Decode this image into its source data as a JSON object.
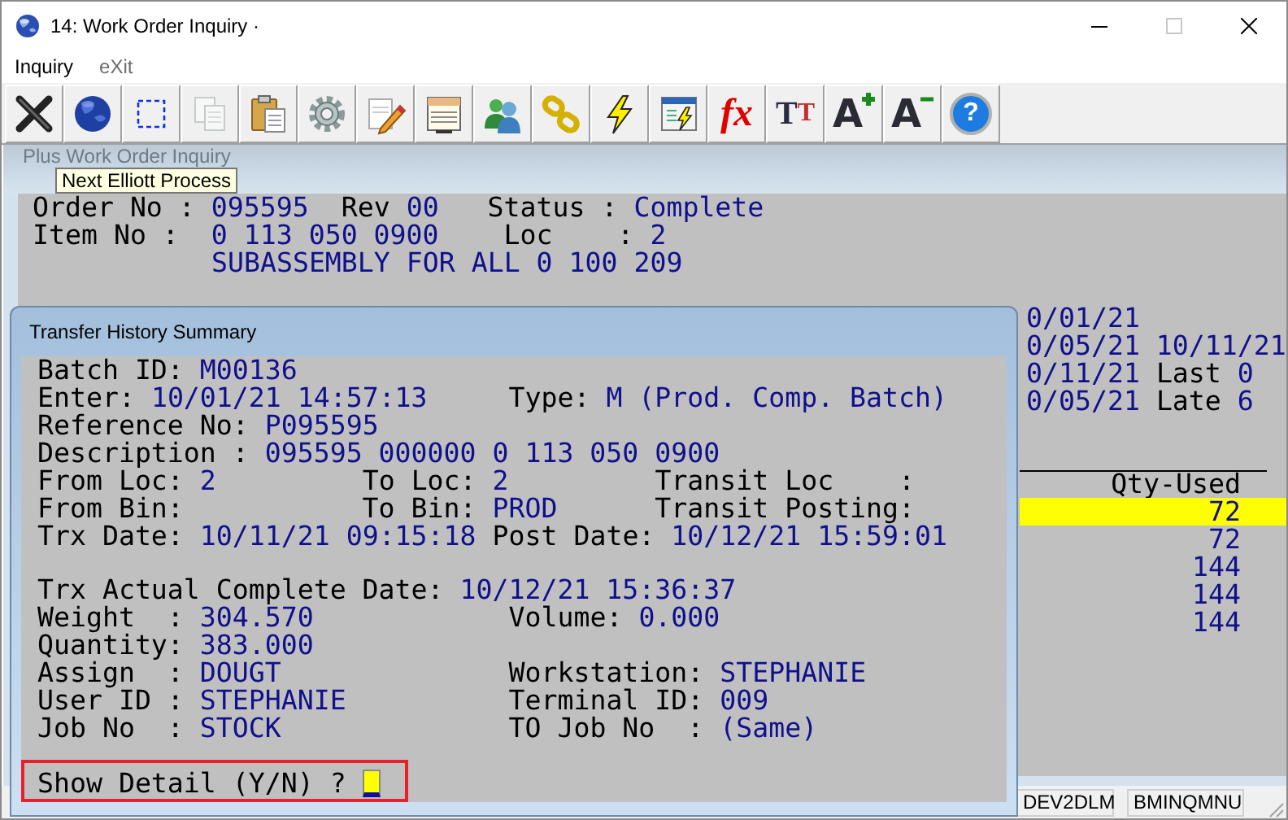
{
  "window": {
    "title": "14: Work Order Inquiry ·"
  },
  "menu": [
    {
      "label": "Inquiry",
      "disabled": false
    },
    {
      "label": "eXit",
      "disabled": true
    }
  ],
  "toolbar": [
    {
      "kind": "close",
      "disabled": false
    },
    {
      "kind": "globe",
      "disabled": false
    },
    {
      "kind": "select",
      "disabled": false
    },
    {
      "kind": "copy",
      "disabled": true
    },
    {
      "kind": "paste",
      "disabled": false
    },
    {
      "kind": "gear",
      "disabled": false
    },
    {
      "kind": "edit",
      "disabled": false
    },
    {
      "kind": "notes",
      "disabled": false
    },
    {
      "kind": "users",
      "disabled": false
    },
    {
      "kind": "chain",
      "disabled": false
    },
    {
      "kind": "lightning",
      "disabled": false
    },
    {
      "kind": "window_lightning",
      "disabled": false
    },
    {
      "kind": "fx",
      "glyph": "fx",
      "disabled": false
    },
    {
      "kind": "text_size",
      "glyph": "TT",
      "disabled": false
    },
    {
      "kind": "font_larger",
      "glyph": "A",
      "disabled": false
    },
    {
      "kind": "font_smaller",
      "glyph": "A",
      "disabled": false
    },
    {
      "kind": "help",
      "glyph": "?",
      "disabled": false
    }
  ],
  "tooltip": "Next Elliott Process",
  "inquiry_window": {
    "title": "Plus Work Order Inquiry",
    "header_lines": [
      [
        {
          "text": "Order No : ",
          "kind": "label"
        },
        {
          "text": "095595",
          "kind": "value"
        },
        {
          "text": "  Rev ",
          "kind": "label"
        },
        {
          "text": "00",
          "kind": "value"
        },
        {
          "text": "   Status : ",
          "kind": "label"
        },
        {
          "text": "Complete",
          "kind": "value"
        }
      ],
      [
        {
          "text": "Item No :  ",
          "kind": "label"
        },
        {
          "text": "0 113 050 0900",
          "kind": "value"
        },
        {
          "text": "    Loc    : ",
          "kind": "label"
        },
        {
          "text": "2",
          "kind": "value"
        }
      ],
      [
        {
          "text": "SUBASSEMBLY FOR ALL 0 100 209",
          "kind": "value"
        }
      ]
    ],
    "schedule_lines": [
      [
        {
          "text": "0/01/21",
          "kind": "value"
        }
      ],
      [
        {
          "text": "0/05/21 10/11/21",
          "kind": "value"
        }
      ],
      [
        {
          "text": "0/11/21",
          "kind": "value"
        },
        {
          "text": " Last ",
          "kind": "label"
        },
        {
          "text": "0",
          "kind": "value"
        }
      ],
      [
        {
          "text": "0/05/21",
          "kind": "value"
        },
        {
          "text": " Late ",
          "kind": "label"
        },
        {
          "text": "6",
          "kind": "value"
        }
      ]
    ],
    "material_table": {
      "columns": [
        "Qty-Used"
      ],
      "rows": [
        {
          "qty_used": "72",
          "selected": true
        },
        {
          "qty_used": "72",
          "selected": false
        },
        {
          "qty_used": "144",
          "selected": false
        },
        {
          "qty_used": "144",
          "selected": false
        },
        {
          "qty_used": "144",
          "selected": false
        }
      ]
    }
  },
  "dialog": {
    "title": "Transfer History Summary",
    "sections": [
      [
        [
          {
            "text": "Batch ID: ",
            "kind": "label"
          },
          {
            "text": "M00136",
            "kind": "value"
          }
        ],
        [
          {
            "text": "Enter: ",
            "kind": "label"
          },
          {
            "text": "10/01/21 14:57:13",
            "kind": "value"
          },
          {
            "text": "     Type: ",
            "kind": "label"
          },
          {
            "text": "M (Prod. Comp. Batch)",
            "kind": "value"
          }
        ],
        [
          {
            "text": "Reference No: ",
            "kind": "label"
          },
          {
            "text": "P095595",
            "kind": "value"
          }
        ],
        [
          {
            "text": "Description : ",
            "kind": "label"
          },
          {
            "text": "095595 000000 0 113 050 0900",
            "kind": "value"
          }
        ],
        [
          {
            "text": "From Loc: ",
            "kind": "label"
          },
          {
            "text": "2",
            "kind": "value"
          },
          {
            "text": "         To Loc: ",
            "kind": "label"
          },
          {
            "text": "2",
            "kind": "value"
          },
          {
            "text": "         Transit Loc    :",
            "kind": "label"
          }
        ],
        [
          {
            "text": "From Bin:           To Bin: ",
            "kind": "label"
          },
          {
            "text": "PROD",
            "kind": "value"
          },
          {
            "text": "      Transit Posting:",
            "kind": "label"
          }
        ],
        [
          {
            "text": "Trx Date: ",
            "kind": "label"
          },
          {
            "text": "10/11/21 09:15:18",
            "kind": "value"
          },
          {
            "text": " Post Date: ",
            "kind": "label"
          },
          {
            "text": "10/12/21 15:59:01",
            "kind": "value"
          }
        ]
      ],
      [
        [
          {
            "text": "Trx Actual Complete Date: ",
            "kind": "label"
          },
          {
            "text": "10/12/21 15:36:37",
            "kind": "value"
          }
        ],
        [
          {
            "text": "Weight  : ",
            "kind": "label"
          },
          {
            "text": "304.570",
            "kind": "value"
          },
          {
            "text": "            Volume: ",
            "kind": "label"
          },
          {
            "text": "0.000",
            "kind": "value"
          }
        ],
        [
          {
            "text": "Quantity: ",
            "kind": "label"
          },
          {
            "text": "383.000",
            "kind": "value"
          }
        ],
        [
          {
            "text": "Assign  : ",
            "kind": "label"
          },
          {
            "text": "DOUGT",
            "kind": "value"
          },
          {
            "text": "              Workstation: ",
            "kind": "label"
          },
          {
            "text": "STEPHANIE",
            "kind": "value"
          }
        ],
        [
          {
            "text": "User ID : ",
            "kind": "label"
          },
          {
            "text": "STEPHANIE",
            "kind": "value"
          },
          {
            "text": "          Terminal ID: ",
            "kind": "label"
          },
          {
            "text": "009",
            "kind": "value"
          }
        ],
        [
          {
            "text": "Job No  : ",
            "kind": "label"
          },
          {
            "text": "STOCK",
            "kind": "value"
          },
          {
            "text": "              TO Job No  : ",
            "kind": "label"
          },
          {
            "text": "(Same)",
            "kind": "value"
          }
        ]
      ]
    ],
    "prompt": {
      "label": "Show Detail (Y/N) ?",
      "outlined": true
    }
  },
  "status_bar": [
    "DEV2DLM",
    "BMINQMNU"
  ]
}
